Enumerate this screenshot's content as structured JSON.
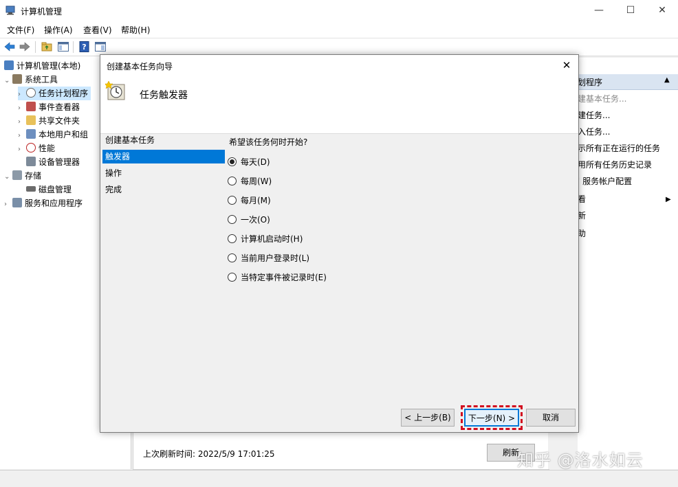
{
  "window": {
    "title": "计算机管理",
    "controls": {
      "minimize": "—",
      "maximize": "☐",
      "close": "✕"
    }
  },
  "menu": [
    "文件(F)",
    "操作(A)",
    "查看(V)",
    "帮助(H)"
  ],
  "tree": {
    "root": "计算机管理(本地)",
    "system_tools": "系统工具",
    "task_scheduler": "任务计划程序",
    "event_viewer": "事件查看器",
    "shared_folders": "共享文件夹",
    "local_users": "本地用户和组",
    "performance": "性能",
    "device_manager": "设备管理器",
    "storage": "存储",
    "disk_management": "磁盘管理",
    "services": "服务和应用程序"
  },
  "actions": {
    "header": "划程序",
    "items": [
      "建基本任务...",
      "建任务...",
      "入任务...",
      "示所有正在运行的任务",
      "用所有任务历史记录",
      "服务帐户配置",
      "看",
      "新",
      "助"
    ]
  },
  "middle": {
    "last_refresh": "上次刷新时间: 2022/5/9 17:01:25",
    "refresh_button": "刷新"
  },
  "dialog": {
    "title": "创建基本任务向导",
    "close": "✕",
    "header_title": "任务触发器",
    "steps": [
      "创建基本任务",
      "触发器",
      "操作",
      "完成"
    ],
    "selected_step": 1,
    "question": "希望该任务何时开始?",
    "options": [
      "每天(D)",
      "每周(W)",
      "每月(M)",
      "一次(O)",
      "计算机启动时(H)",
      "当前用户登录时(L)",
      "当特定事件被记录时(E)"
    ],
    "selected_option": 0,
    "buttons": {
      "back": "< 上一步(B)",
      "next": "下一步(N) >",
      "cancel": "取消"
    }
  },
  "watermark": "知乎 @洛水如云",
  "colors": {
    "accent": "#0078d7",
    "highlight": "#d10a1e"
  }
}
